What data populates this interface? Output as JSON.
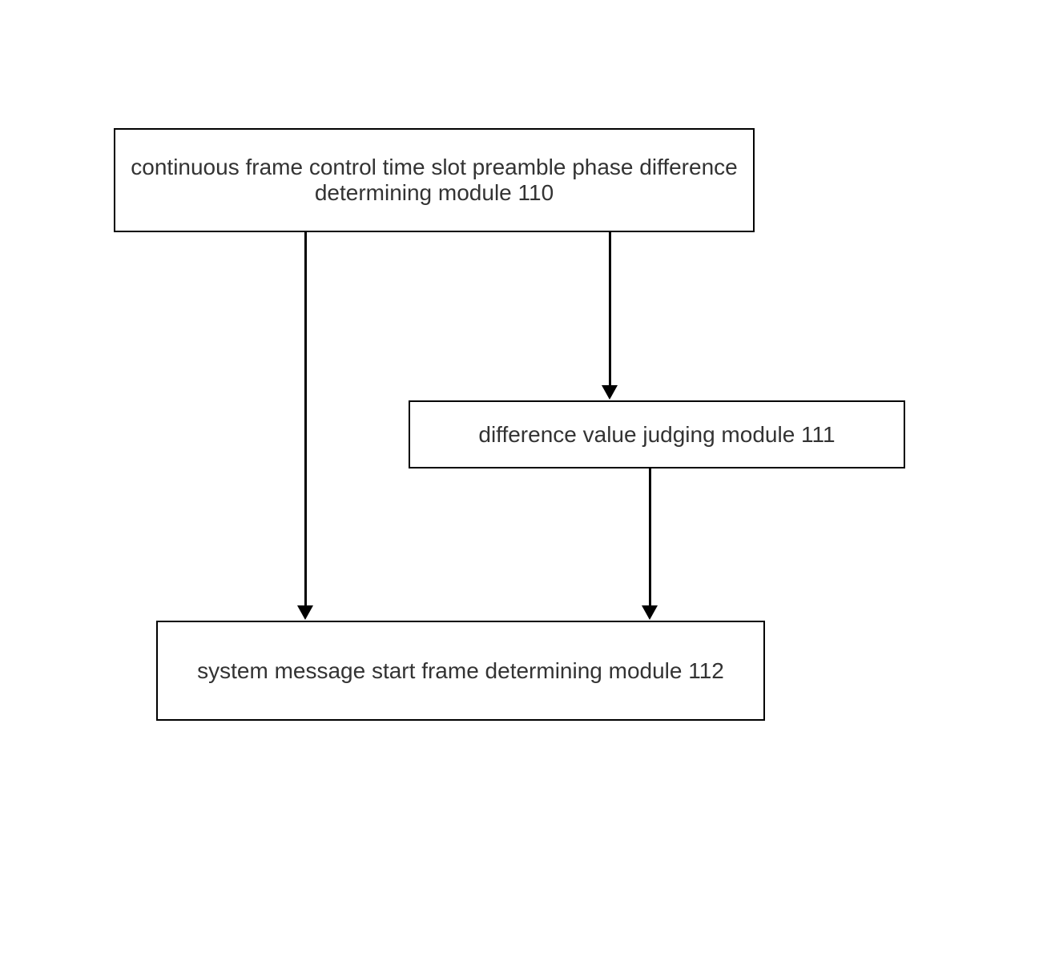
{
  "boxes": {
    "box110": "continuous frame control time slot preamble phase difference determining module 110",
    "box111": "difference value judging module 111",
    "box112": "system message start frame determining module 112"
  }
}
